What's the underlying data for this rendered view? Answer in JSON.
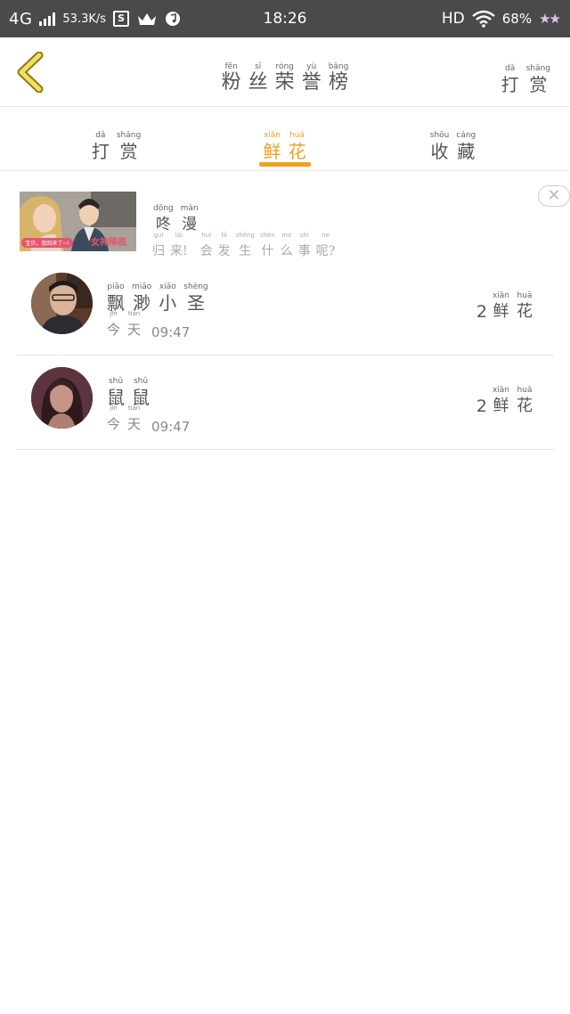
{
  "status_bar": {
    "network": "4G",
    "speed": "53.3K/s",
    "time": "18:26",
    "hd": "HD",
    "battery": "68%",
    "box_glyph": "S"
  },
  "header": {
    "title": [
      {
        "p": "fěn",
        "h": "粉"
      },
      {
        "p": "sī",
        "h": "丝"
      },
      {
        "p": "róng",
        "h": "荣"
      },
      {
        "p": "yù",
        "h": "誉"
      },
      {
        "p": "bǎng",
        "h": "榜"
      }
    ],
    "reward": [
      {
        "p": "dǎ",
        "h": "打"
      },
      {
        "p": "shǎng",
        "h": "赏"
      }
    ]
  },
  "tabs": [
    {
      "chars": [
        {
          "p": "dǎ",
          "h": "打"
        },
        {
          "p": "shǎng",
          "h": "赏"
        }
      ],
      "active": false
    },
    {
      "chars": [
        {
          "p": "xiān",
          "h": "鲜"
        },
        {
          "p": "huā",
          "h": "花"
        }
      ],
      "active": true
    },
    {
      "chars": [
        {
          "p": "shōu",
          "h": "收"
        },
        {
          "p": "cáng",
          "h": "藏"
        }
      ],
      "active": false
    }
  ],
  "ad": {
    "name": [
      {
        "p": "dōng",
        "h": "咚"
      },
      {
        "p": "màn",
        "h": "漫"
      }
    ],
    "desc": [
      {
        "p": "guī",
        "h": "归"
      },
      {
        "p": "lái",
        "h": "来!"
      },
      {
        "p": "huì",
        "h": "会"
      },
      {
        "p": "fā",
        "h": "发"
      },
      {
        "p": "shēng",
        "h": "生"
      },
      {
        "p": "shén",
        "h": "什"
      },
      {
        "p": "me",
        "h": "么"
      },
      {
        "p": "shì",
        "h": "事"
      },
      {
        "p": "ne",
        "h": "呢?"
      }
    ],
    "close_symbol": "✕",
    "banner_text": "女神降临",
    "banner_caption": "宝贝，我回来了~!",
    "icon": "close-icon"
  },
  "rows": [
    {
      "name": [
        {
          "p": "piāo",
          "h": "飘"
        },
        {
          "p": "miǎo",
          "h": "渺"
        },
        {
          "p": "xiǎo",
          "h": "小"
        },
        {
          "p": "shèng",
          "h": "圣"
        }
      ],
      "day": [
        {
          "p": "jīn",
          "h": "今"
        },
        {
          "p": "tiān",
          "h": "天"
        }
      ],
      "time": "09:47",
      "count": "2",
      "unit": [
        {
          "p": "xiān",
          "h": "鲜"
        },
        {
          "p": "huā",
          "h": "花"
        }
      ]
    },
    {
      "name": [
        {
          "p": "shǔ",
          "h": "鼠"
        },
        {
          "p": "shǔ",
          "h": "鼠"
        }
      ],
      "day": [
        {
          "p": "jīn",
          "h": "今"
        },
        {
          "p": "tiān",
          "h": "天"
        }
      ],
      "time": "09:47",
      "count": "2",
      "unit": [
        {
          "p": "xiān",
          "h": "鲜"
        },
        {
          "p": "huā",
          "h": "花"
        }
      ]
    }
  ],
  "colors": {
    "accent": "#f0a020",
    "status_bar": "#4a4a4a",
    "text": "#555555",
    "divider": "#e4e4e4"
  }
}
